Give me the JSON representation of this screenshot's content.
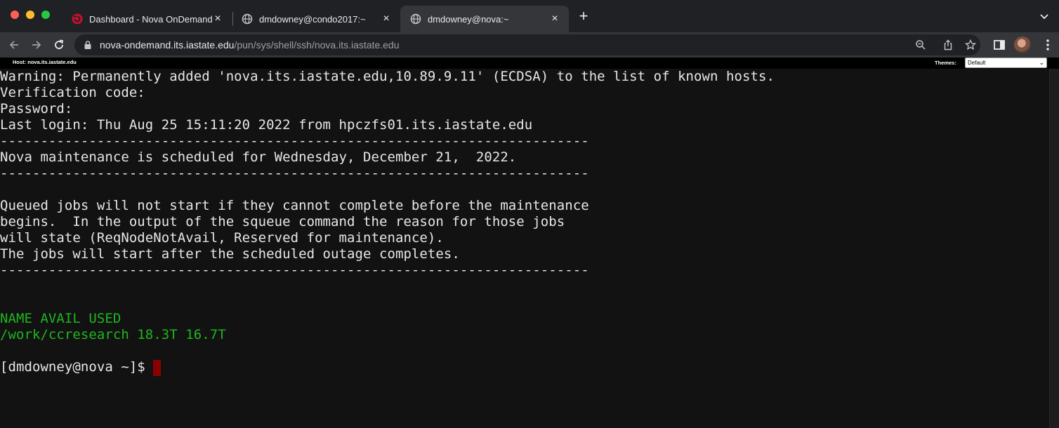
{
  "browser": {
    "tabs": [
      {
        "title": "Dashboard - Nova OnDemand",
        "favicon": "ondemand-logo-icon",
        "active": false
      },
      {
        "title": "dmdowney@condo2017:~",
        "favicon": "globe-icon",
        "active": false
      },
      {
        "title": "dmdowney@nova:~",
        "favicon": "globe-icon",
        "active": true
      }
    ],
    "url_host": "nova-ondemand.its.iastate.edu",
    "url_path": "/pun/sys/shell/ssh/nova.its.iastate.edu",
    "new_tab_symbol": "+",
    "close_symbol": "×"
  },
  "hostbar": {
    "host_label": "Host: nova.its.iastate.edu",
    "themes_label": "Themes:",
    "theme_selected": "Default"
  },
  "terminal": {
    "lines": [
      {
        "text": "Warning: Permanently added 'nova.its.iastate.edu,10.89.9.11' (ECDSA) to the list of known hosts.",
        "color": "default"
      },
      {
        "text": "Verification code:",
        "color": "default"
      },
      {
        "text": "Password:",
        "color": "default"
      },
      {
        "text": "Last login: Thu Aug 25 15:11:20 2022 from hpczfs01.its.iastate.edu",
        "color": "default"
      },
      {
        "text": "-------------------------------------------------------------------------",
        "color": "default"
      },
      {
        "text": "Nova maintenance is scheduled for Wednesday, December 21,  2022.",
        "color": "default"
      },
      {
        "text": "-------------------------------------------------------------------------",
        "color": "default"
      },
      {
        "text": "",
        "color": "default"
      },
      {
        "text": "Queued jobs will not start if they cannot complete before the maintenance",
        "color": "default"
      },
      {
        "text": "begins.  In the output of the squeue command the reason for those jobs",
        "color": "default"
      },
      {
        "text": "will state (ReqNodeNotAvail, Reserved for maintenance).",
        "color": "default"
      },
      {
        "text": "The jobs will start after the scheduled outage completes.",
        "color": "default"
      },
      {
        "text": "-------------------------------------------------------------------------",
        "color": "default"
      },
      {
        "text": "",
        "color": "default"
      },
      {
        "text": "",
        "color": "default"
      },
      {
        "text": "NAME AVAIL USED",
        "color": "green"
      },
      {
        "text": "/work/ccresearch 18.3T 16.7T",
        "color": "green"
      },
      {
        "text": "",
        "color": "default"
      },
      {
        "text": "[dmdowney@nova ~]$ ",
        "color": "default"
      }
    ],
    "colors": {
      "default": "#e7e7e7",
      "green": "#1fb51f",
      "cursor": "#8b0000",
      "background": "#121212"
    }
  }
}
